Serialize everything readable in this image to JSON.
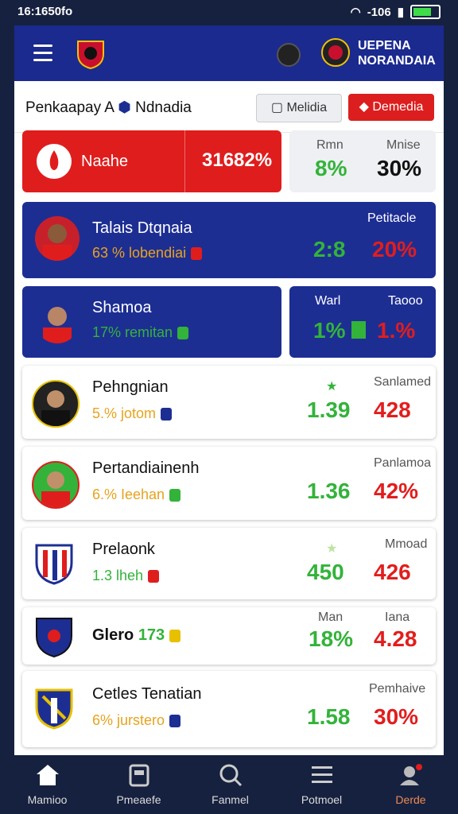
{
  "status_bar": {
    "time": "16:1650fo",
    "signal": "-106"
  },
  "header": {
    "brand_line1": "UEPENA",
    "brand_line2": "NORANDAIA"
  },
  "filter": {
    "title": "Penkaapay A",
    "title2": "Ndnadia",
    "grey_btn": "Melidia",
    "red_btn": "Demedia"
  },
  "highlight": {
    "label": "Naahe",
    "value": "31682%",
    "col1_label": "Rmn",
    "col2_label": "Mnise",
    "col1_value": "8%",
    "col2_value": "30%"
  },
  "players": [
    {
      "name": "Talais Dtqnaia",
      "sub": "63 % lobendiai",
      "header": "Petitacle",
      "v1": "2:8",
      "v2": "20%"
    },
    {
      "name": "Shamoa",
      "sub": "17% remitan",
      "h1": "Warl",
      "h2": "Taooo",
      "v1": "1%",
      "v2": "1.%"
    }
  ],
  "list": [
    {
      "name": "Pehngnian",
      "sub": "5.% jotom",
      "header": "Sanlamed",
      "v1": "1.39",
      "v2": "428"
    },
    {
      "name": "Pertandiainenh",
      "sub": "6.% Ieehan",
      "header": "Panlamoa",
      "v1": "1.36",
      "v2": "42%"
    },
    {
      "name": "Prelaonk",
      "sub": "1.3 lheh",
      "header": "Mmoad",
      "v1": "450",
      "v2": "426"
    },
    {
      "name": "Glero",
      "sub": "173",
      "h1": "Man",
      "h2": "Iana",
      "v1": "18%",
      "v2": "4.28"
    },
    {
      "name": "Cetles Tenatian",
      "sub": "6% jurstero",
      "header": "Pemhaive",
      "v1": "1.58",
      "v2": "30%"
    }
  ],
  "tabs": [
    "Mamioo",
    "Pmeaefe",
    "Fanmel",
    "Potmoel",
    "Derde"
  ],
  "colors": {
    "primary_blue": "#1d2e93",
    "accent_red": "#e01d1d",
    "positive_green": "#33b33a"
  }
}
